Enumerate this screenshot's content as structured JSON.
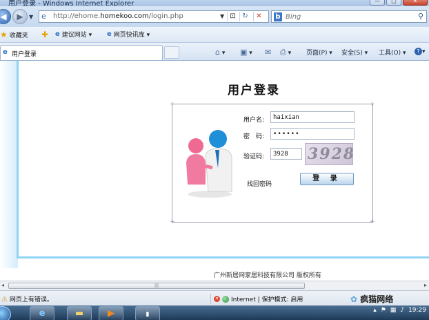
{
  "window": {
    "title": "用户登录 - Windows Internet Explorer",
    "buttons": {
      "minimize": "—",
      "maximize": "□",
      "close": "✕"
    }
  },
  "address_bar": {
    "url_prefix": "http://ehome.",
    "url_domain": "homekoo.com",
    "url_path": "/login.php",
    "search_placeholder": "Bing"
  },
  "favorites_bar": {
    "favorites_label": "收藏夹",
    "items": [
      "建议网站 ▾",
      "网页快讯库 ▾"
    ]
  },
  "tab": {
    "label": "用户登录"
  },
  "command_bar": {
    "page_menu": "页面(P) ▾",
    "safety_menu": "安全(S) ▾",
    "tools_menu": "工具(O) ▾",
    "help_menu": "▾"
  },
  "page": {
    "heading": "用户登录",
    "form": {
      "username_label": "用户名:",
      "username_value": "haixian",
      "password_label": "密　码:",
      "password_value": "••••••",
      "captcha_label": "验证码:",
      "captcha_value": "3928",
      "captcha_image_text": "3928",
      "forgot_password": "找回密码",
      "login_button": "登 录"
    },
    "copyright": "广州新居网家居科技有限公司 版权所有"
  },
  "status_bar": {
    "left_text": "网页上有错误。",
    "zone_text": "Internet | 保护模式: 启用",
    "watermark": "疯猫网络"
  },
  "taskbar": {
    "clock": "19:29"
  },
  "colors": {
    "frame_accent": "#8fd4f5",
    "ie_blue": "#2d72c8"
  }
}
